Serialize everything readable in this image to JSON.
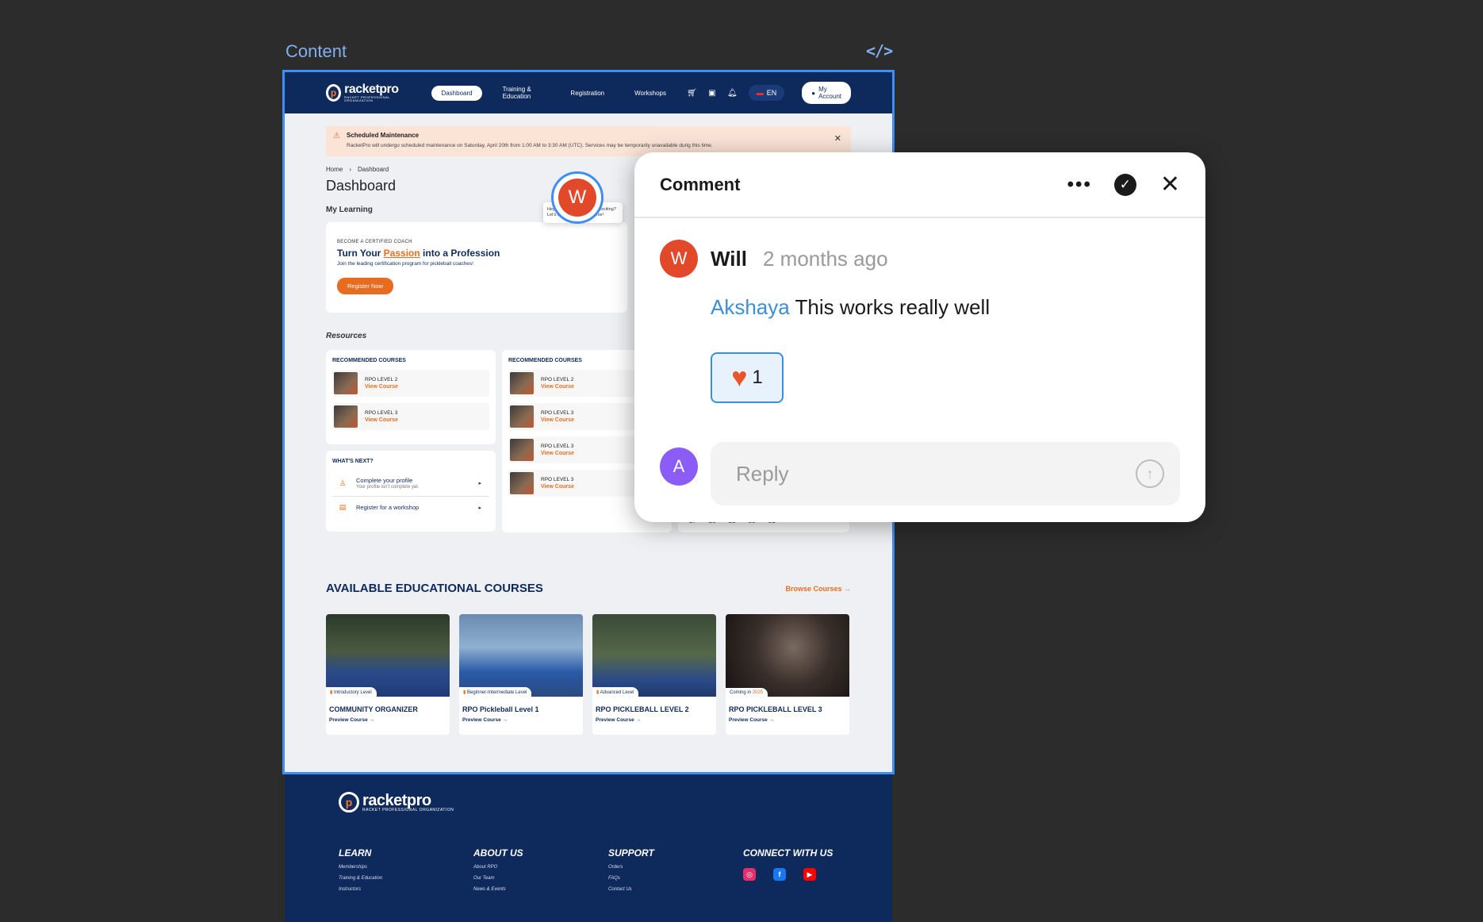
{
  "canvas": {
    "frame_label": "Content",
    "code_icon": "code-icon"
  },
  "header": {
    "logo_name": "racketpro",
    "logo_sub": "RACKET PROFESSIONAL ORGANIZATION",
    "nav": [
      "Dashboard",
      "Training & Education",
      "Registration",
      "Workshops"
    ],
    "lang": "EN",
    "account": "My Account"
  },
  "alert": {
    "title": "Scheduled Maintenance",
    "message": "RacketPro will undergo scheduled maintenance on Saturday, April 20th from 1:00 AM to 3:30 AM (UTC). Services may be temporarily unavailable durig this time."
  },
  "breadcrumb": {
    "home": "Home",
    "current": "Dashboard"
  },
  "page_title": "Dashboard",
  "my_learning": {
    "title": "My Learning",
    "kicker": "BECOME A CERTIFIED COACH",
    "headline_pre": "Turn Your ",
    "headline_hl": "Passion",
    "headline_post": " into a Profession",
    "sub": "Join the leading certification program for pickleball coaches!",
    "cta": "Register Now",
    "tooltip": "Hey! Ready for something exciting? Let's unlock your first course!"
  },
  "resources": {
    "title": "Resources",
    "col1_title": "RECOMMENDED COURSES",
    "col1_courses": [
      {
        "name": "RPO LEVEL 2",
        "link": "View Course"
      },
      {
        "name": "RPO LEVEL 3",
        "link": "View Course"
      }
    ],
    "col2_title": "RECOMMENDED COURSES",
    "col2_courses": [
      {
        "name": "RPO LEVEL 2",
        "link": "View Course"
      },
      {
        "name": "RPO LEVEL 3",
        "link": "View Course"
      },
      {
        "name": "RPO LEVEL 3",
        "link": "View Course"
      },
      {
        "name": "RPO LEVEL 3",
        "link": "View Course"
      }
    ],
    "next_title": "WHAT'S NEXT?",
    "next_items": [
      {
        "title": "Complete your profile",
        "sub": "Your profile isn't complete yet."
      },
      {
        "title": "Register for a workshop",
        "sub": ""
      }
    ],
    "calendar_days": [
      "27",
      "28",
      "29",
      "30",
      "31"
    ]
  },
  "available": {
    "title": "AVAILABLE EDUCATIONAL COURSES",
    "browse": "Browse Courses",
    "courses": [
      {
        "level": "Introductory Level",
        "name": "COMMUNITY ORGANIZER",
        "cta": "Preview Course"
      },
      {
        "level": "Beginner-Intermediate Level",
        "name": "RPO Pickleball Level 1",
        "cta": "Preview Course"
      },
      {
        "level": "Advanced Level",
        "name": "RPO PICKLEBALL LEVEL 2",
        "cta": "Preview Course"
      },
      {
        "level_pre": "Coming in ",
        "level_yr": "2025",
        "name": "RPO PICKLEBALL LEVEL 3",
        "cta": "Preview Course"
      }
    ]
  },
  "footer": {
    "learn": {
      "title": "LEARN",
      "links": [
        "Memberships",
        "Training & Education",
        "Instructors"
      ]
    },
    "about": {
      "title": "ABOUT US",
      "links": [
        "About RPO",
        "Our Team",
        "News & Events"
      ]
    },
    "support": {
      "title": "SUPPORT",
      "links": [
        "Orders",
        "FAQs",
        "Contact Us"
      ]
    },
    "connect": {
      "title": "CONNECT WITH US"
    }
  },
  "comment": {
    "title": "Comment",
    "author": "Will",
    "author_initial": "W",
    "time": "2 months ago",
    "mention": "Akshaya",
    "body": " This works really well",
    "reaction_count": "1",
    "reply_initial": "A",
    "reply_placeholder": "Reply"
  },
  "colors": {
    "navy": "#0e2a5c",
    "orange": "#e86c1f",
    "selection_blue": "#3d8ef5",
    "will_avatar": "#e2482a",
    "akshaya_avatar": "#8b5cf6",
    "mention": "#3b8ed8"
  }
}
